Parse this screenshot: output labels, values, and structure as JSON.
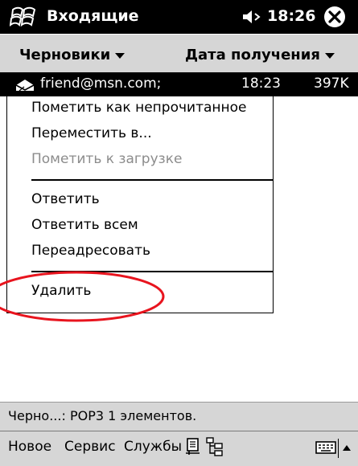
{
  "titlebar": {
    "title": "Входящие",
    "time": "18:26"
  },
  "filterbar": {
    "folder_label": "Черновики",
    "sort_label": "Дата получения"
  },
  "message": {
    "from": "friend@msn.com;",
    "time": "18:23",
    "size": "397K"
  },
  "context_menu": {
    "items": [
      {
        "label": "Пометить как непрочитанное",
        "enabled": true
      },
      {
        "label": "Переместить в...",
        "enabled": true
      },
      {
        "label": "Пометить к загрузке",
        "enabled": false
      },
      {
        "label": "Ответить",
        "enabled": true
      },
      {
        "label": "Ответить всем",
        "enabled": true
      },
      {
        "label": "Переадресовать",
        "enabled": true
      },
      {
        "label": "Удалить",
        "enabled": true
      }
    ]
  },
  "status": {
    "text": "Черно...: POP3 1 элементов."
  },
  "menubar": {
    "new_label": "Новое",
    "service_label": "Сервис",
    "services_label": "Службы",
    "icons": [
      "send-receive-icon",
      "folder-list-icon",
      "keyboard-icon",
      "input-arrow-icon"
    ]
  },
  "colors": {
    "bar_gray": "#d6d6d6",
    "title_black": "#000000",
    "disabled_text": "#8c8c8c",
    "annotation_red": "#e8141e"
  }
}
